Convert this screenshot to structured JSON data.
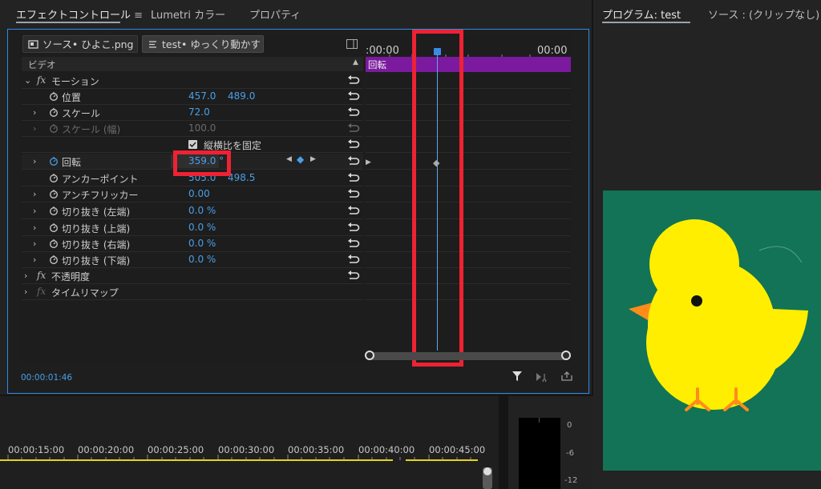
{
  "tabs": {
    "effect_controls": "エフェクトコントロール",
    "lumetri": "Lumetri カラー",
    "properties": "プロパティ",
    "program": "プログラム: test",
    "source": "ソース : (クリップなし)"
  },
  "sequence_chips": {
    "source": "ソース• ひよこ.png",
    "sequence": "test• ゆっくり動かす"
  },
  "section": {
    "video": "ビデオ"
  },
  "effects": {
    "motion": "モーション",
    "opacity": "不透明度",
    "time_remap": "タイムリマップ"
  },
  "properties": [
    {
      "label": "位置",
      "v1": "457.0",
      "v2": "489.0"
    },
    {
      "label": "スケール",
      "v1": "72.0",
      "v2": ""
    },
    {
      "label": "スケール (幅)",
      "v1": "100.0",
      "v2": ""
    },
    {
      "label": "縦横比を固定",
      "v1": "",
      "v2": ""
    },
    {
      "label": "回転",
      "v1": "359.0 °",
      "v2": ""
    },
    {
      "label": "アンカーポイント",
      "v1": "505.0",
      "v2": "498.5"
    },
    {
      "label": "アンチフリッカー",
      "v1": "0.00",
      "v2": ""
    },
    {
      "label": "切り抜き (左端)",
      "v1": "0.0 %",
      "v2": ""
    },
    {
      "label": "切り抜き (上端)",
      "v1": "0.0 %",
      "v2": ""
    },
    {
      "label": "切り抜き (右端)",
      "v1": "0.0 %",
      "v2": ""
    },
    {
      "label": "切り抜き (下端)",
      "v1": "0.0 %",
      "v2": ""
    }
  ],
  "keyframe_clip_label": "回転",
  "ec_timeline": {
    "start": ":00:00",
    "end": "00:00"
  },
  "current_time": "00:00:01:46",
  "lower_timeline": {
    "timecodes": [
      "00:00:15:00",
      "00:00:20:00",
      "00:00:25:00",
      "00:00:30:00",
      "00:00:35:00",
      "00:00:40:00",
      "00:00:45:00"
    ]
  },
  "meter": {
    "labels": [
      "0",
      "-6",
      "-12"
    ]
  },
  "colors": {
    "accent_blue": "#2d8ceb",
    "value_blue": "#4a9fe8",
    "clip_purple": "#7b1a9e",
    "highlight_red": "#ee2233",
    "program_bg": "#127356",
    "chick_yellow": "#ffee00"
  }
}
